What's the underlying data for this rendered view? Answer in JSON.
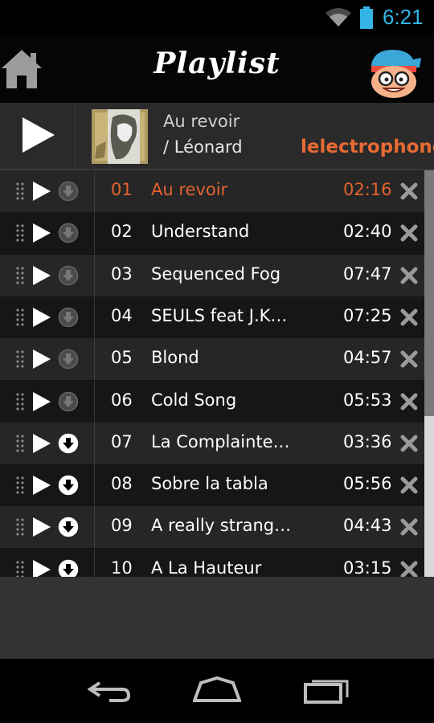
{
  "status_bar": {
    "time": "6:21"
  },
  "header": {
    "title": "Playlist"
  },
  "now_playing": {
    "song": "Au revoir",
    "artist": "/ Léonard",
    "brand_prefix": "lelectro",
    "brand_suffix": "phone"
  },
  "tracks": [
    {
      "num": "01",
      "title": "Au revoir",
      "duration": "02:16",
      "active": true
    },
    {
      "num": "02",
      "title": "Understand",
      "duration": "02:40"
    },
    {
      "num": "03",
      "title": "Sequenced Fog",
      "duration": "07:47"
    },
    {
      "num": "04",
      "title": "SEULS feat J.K…",
      "duration": "07:25"
    },
    {
      "num": "05",
      "title": "Blond",
      "duration": "04:57"
    },
    {
      "num": "06",
      "title": "Cold Song",
      "duration": "05:53"
    },
    {
      "num": "07",
      "title": "La Complainte…",
      "duration": "03:36"
    },
    {
      "num": "08",
      "title": "Sobre la tabla",
      "duration": "05:56"
    },
    {
      "num": "09",
      "title": "A really strang…",
      "duration": "04:43"
    },
    {
      "num": "10",
      "title": "A La Hauteur",
      "duration": "03:15"
    }
  ],
  "colors": {
    "accent": "#e2632f",
    "status_blue": "#33b5e5"
  },
  "icons": {
    "home": "home-icon",
    "grip": "drag-handle-icon",
    "play": "play-icon",
    "download": "download-icon",
    "remove": "close-icon"
  }
}
